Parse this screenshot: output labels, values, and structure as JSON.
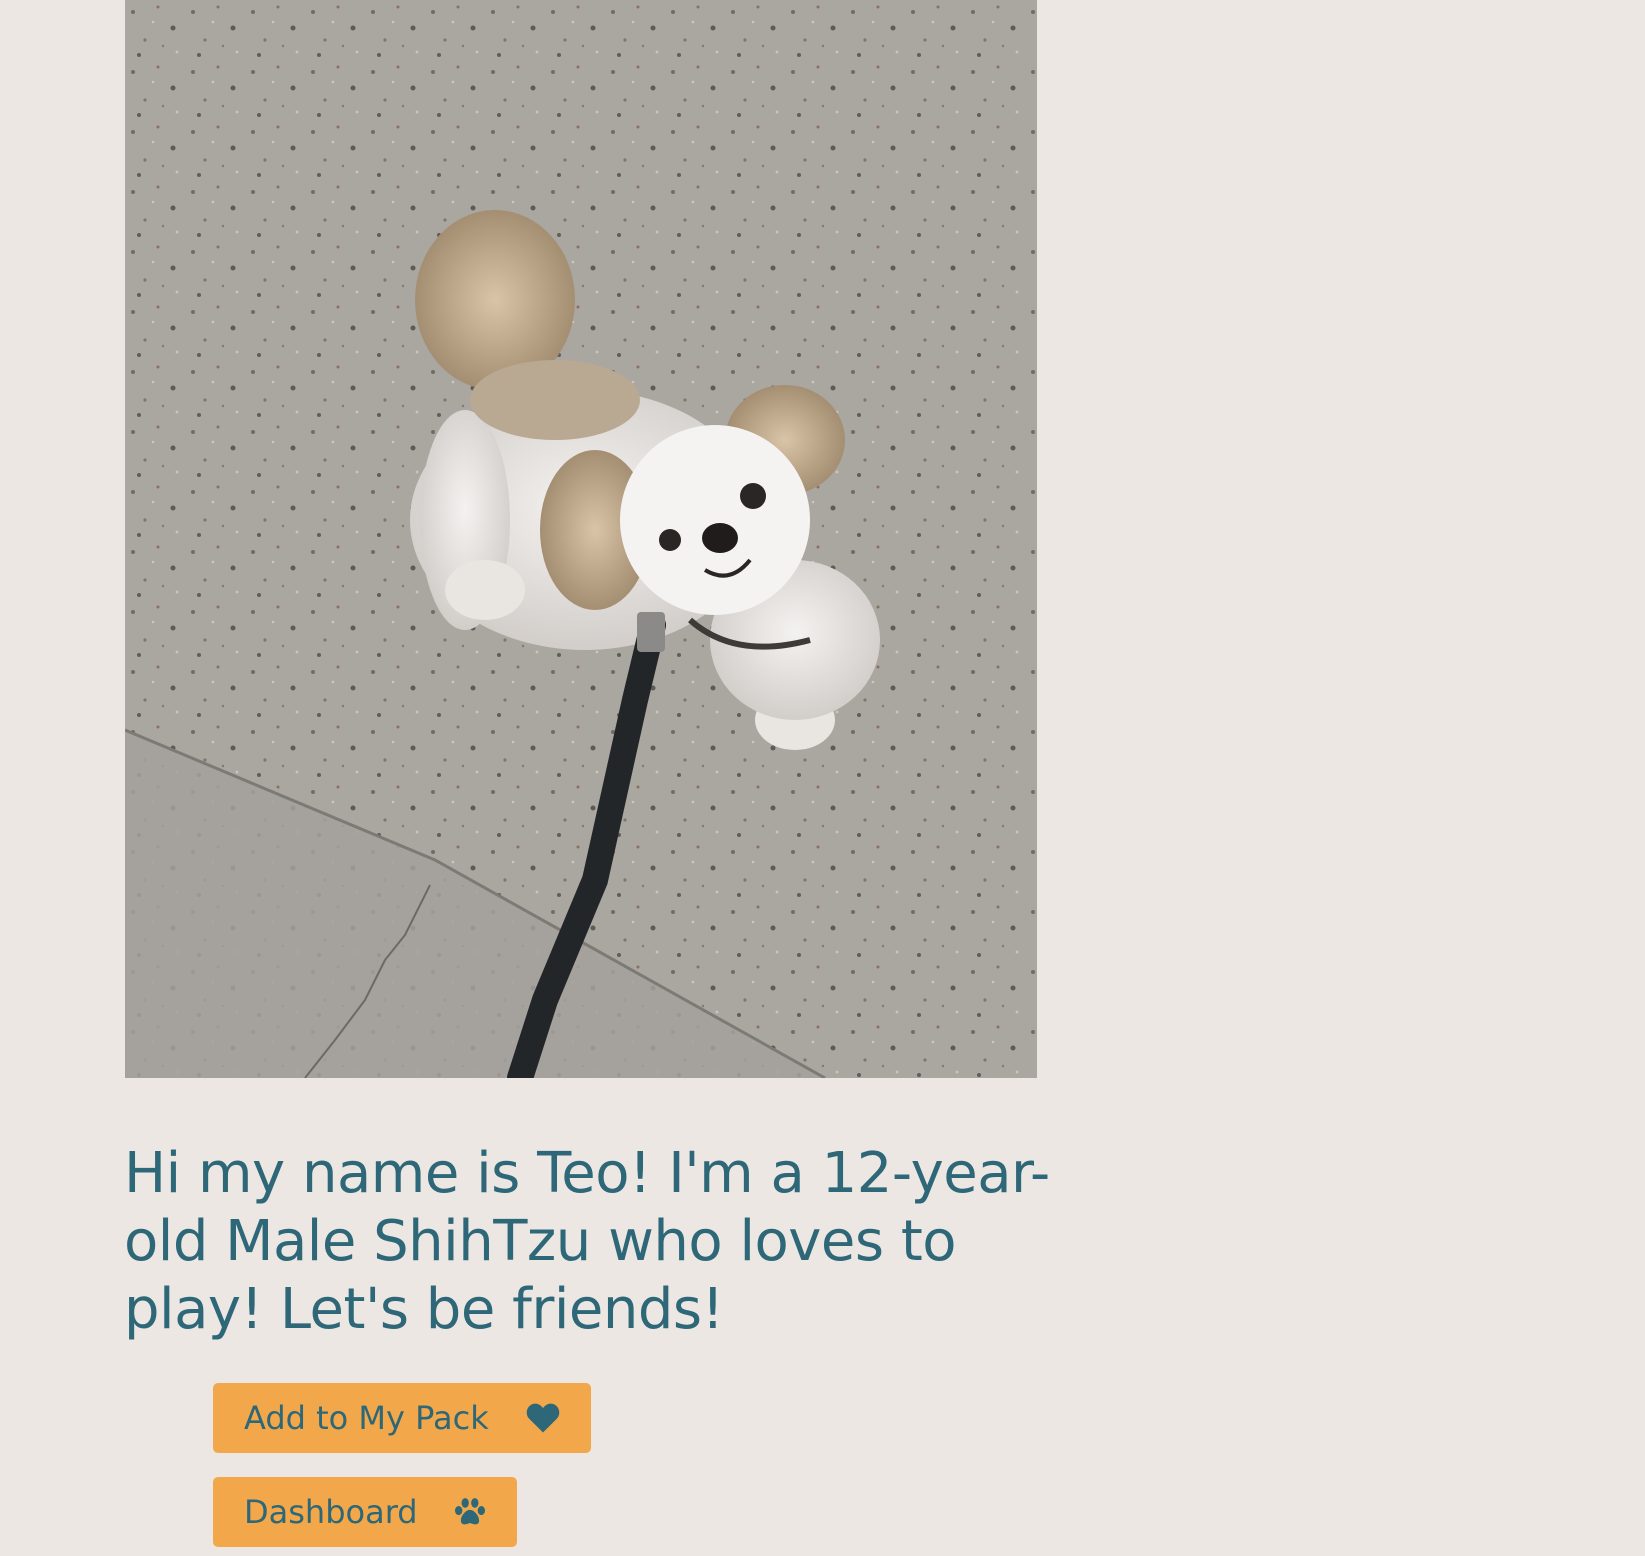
{
  "profile": {
    "photo_alt": "Teo",
    "bio": "Hi my name is Teo! I'm a 12-year-old Male ShihTzu who loves to play! Let's be friends!"
  },
  "actions": {
    "add_to_pack_label": "Add to My Pack",
    "add_to_pack_icon": "heart-icon",
    "dashboard_label": "Dashboard",
    "dashboard_icon": "paw-icon"
  },
  "colors": {
    "background": "#ece7e3",
    "text": "#2e6878",
    "button": "#f2a84a"
  }
}
